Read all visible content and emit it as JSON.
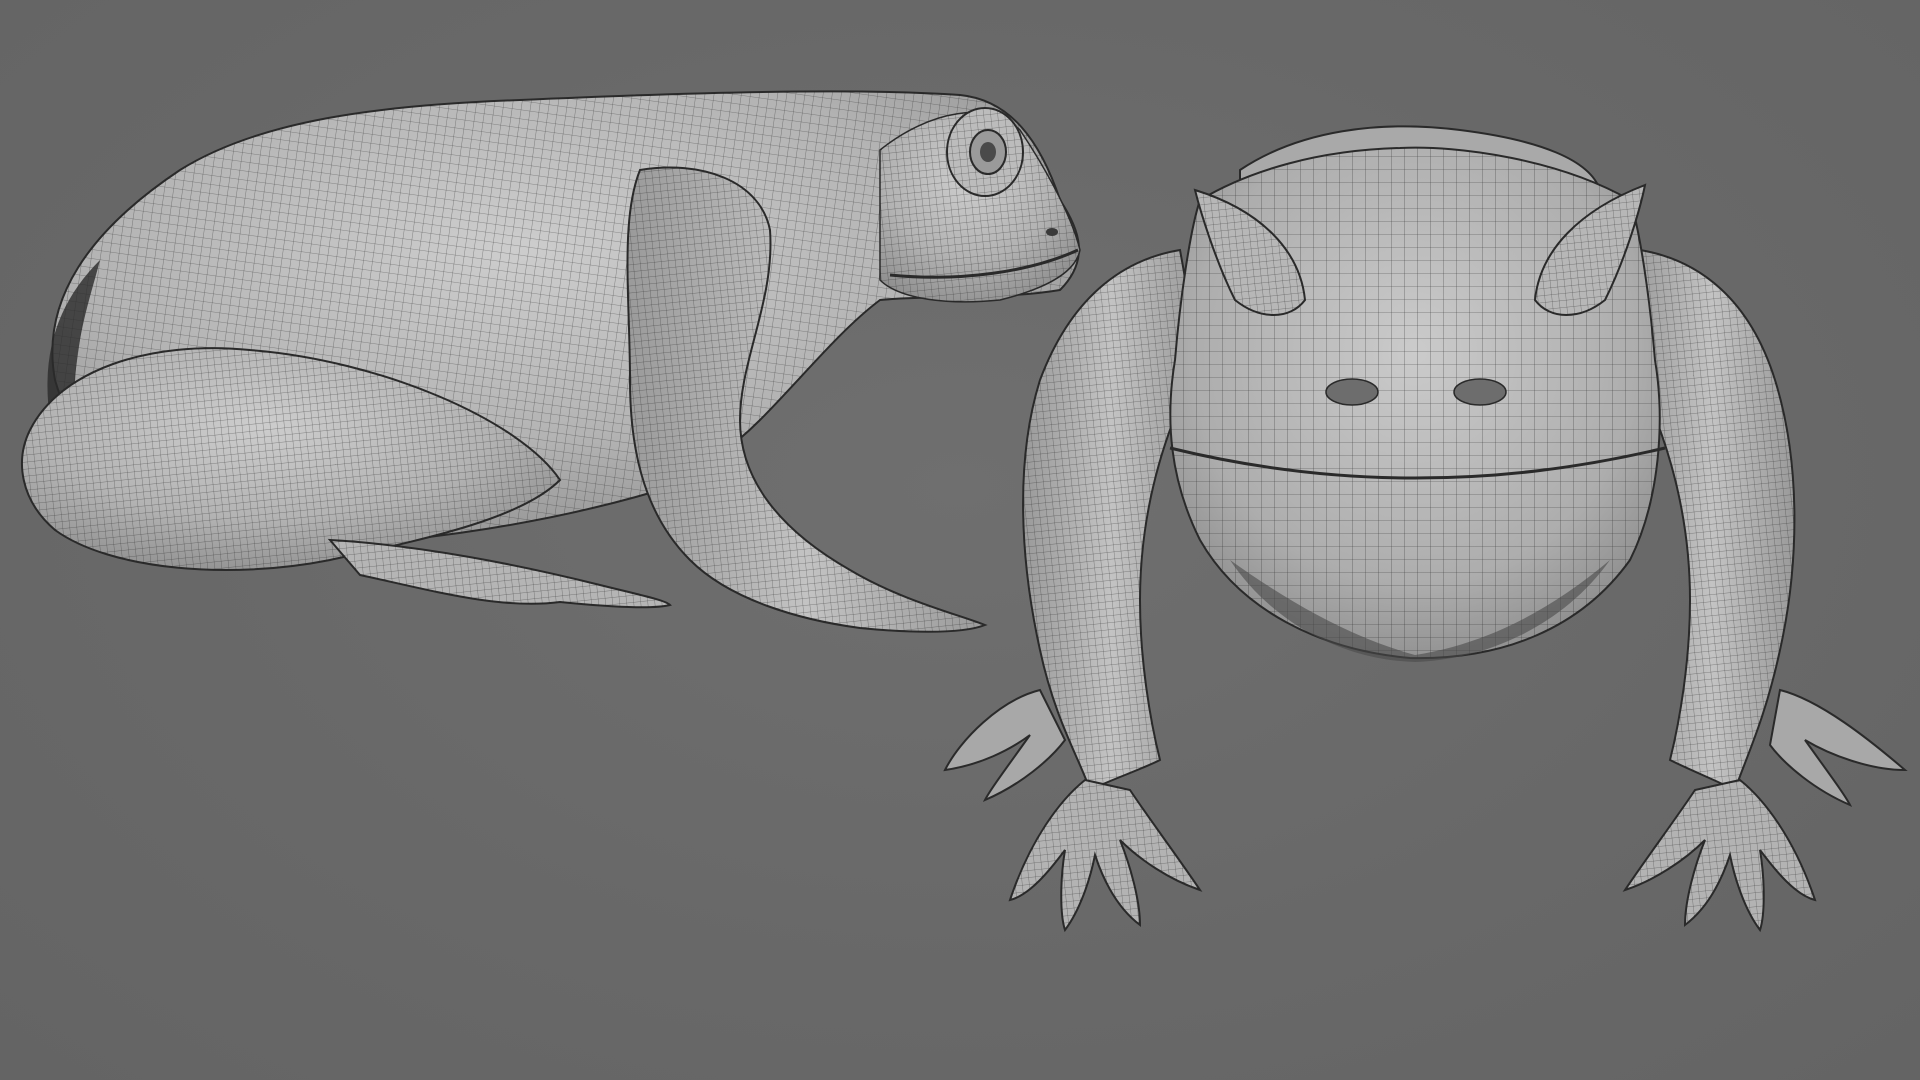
{
  "viewport": {
    "background_color": "#6b6b6b",
    "mesh_fill_color": "#b9b9b9",
    "wire_color": "#1e1e1e"
  },
  "models": [
    {
      "name": "frog-side-view",
      "kind": "3D wireframe render"
    },
    {
      "name": "frog-front-view",
      "kind": "3D wireframe render"
    }
  ]
}
